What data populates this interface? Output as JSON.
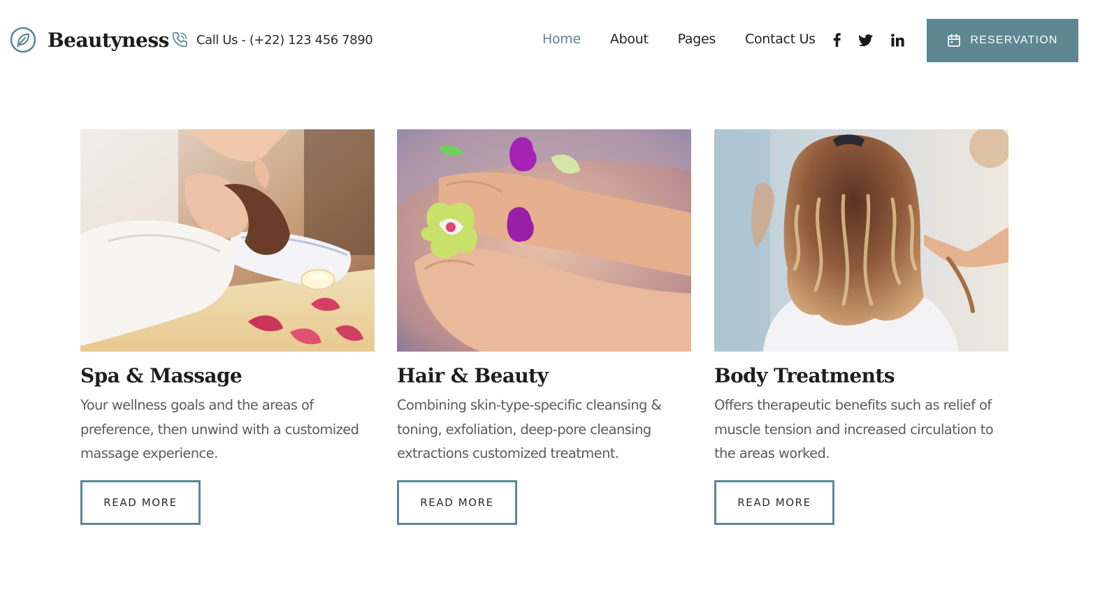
{
  "brand": {
    "name": "Beautyness",
    "icon": "leaf-circle-icon"
  },
  "contact": {
    "call_text": "Call Us - (+22) 123 456 7890",
    "icon": "phone-icon"
  },
  "nav": {
    "items": [
      {
        "label": "Home",
        "active": true
      },
      {
        "label": "About",
        "active": false
      },
      {
        "label": "Pages",
        "active": false
      },
      {
        "label": "Contact Us",
        "active": false
      }
    ]
  },
  "social": [
    {
      "icon": "facebook-icon"
    },
    {
      "icon": "twitter-icon"
    },
    {
      "icon": "linkedin-icon"
    }
  ],
  "reservation": {
    "label": "RESERVATION",
    "icon": "calendar-icon"
  },
  "colors": {
    "accent": "#5e8792",
    "nav_active": "#5b8590",
    "text_dark": "#1e1e1e",
    "text_body": "#5b5b5b"
  },
  "services": [
    {
      "image": "spa-massage-photo",
      "title": "Spa & Massage",
      "description": "Your wellness goals and the areas of preference, then unwind with a customized massage experience.",
      "button": "READ MORE"
    },
    {
      "image": "foot-spa-photo",
      "title": "Hair & Beauty",
      "description": "Combining skin-type-specific cleansing & toning, exfoliation, deep-pore cleansing extractions customized treatment.",
      "button": "READ MORE"
    },
    {
      "image": "curly-hair-styling-photo",
      "title": "Body Treatments",
      "description": "Offers therapeutic benefits such as relief of muscle tension and increased circulation to the areas worked.",
      "button": "READ MORE"
    }
  ]
}
